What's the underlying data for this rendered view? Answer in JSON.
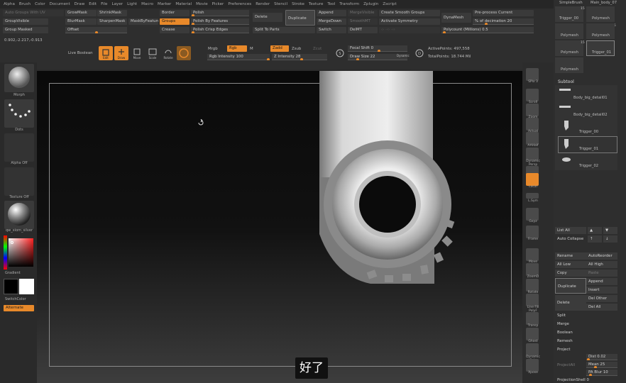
{
  "menu": [
    "Alpha",
    "Brush",
    "Color",
    "Document",
    "Draw",
    "Edit",
    "File",
    "Layer",
    "Light",
    "Macro",
    "Marker",
    "Material",
    "Movie",
    "Picker",
    "Preferences",
    "Render",
    "Stencil",
    "Stroke",
    "Texture",
    "Tool",
    "Transform",
    "Zplugin",
    "Zscript"
  ],
  "top_buttons": {
    "auto_groups": "Auto Groups With UV",
    "group_visible": "GroupVisible",
    "group_masked": "Group Masked",
    "coords": "0.902,-2.217,-0.913",
    "grow_mask": "GrowMask",
    "shrink_mask": "ShrinkMask",
    "blur_mask": "BlurMask",
    "sharpen_mask": "SharpenMask",
    "offset": "Offset",
    "mask_by_feature": "MaskByFeature",
    "border": "Border",
    "groups": "Groups",
    "crease": "Crease",
    "polish": "Polish",
    "polish_by_features": "Polish By Features",
    "polish_crisp": "Polish Crisp Edges",
    "delete": "Delete",
    "duplicate": "Duplicate",
    "split_to_parts": "Split To Parts",
    "append": "Append",
    "merge_down": "MergeDown",
    "switch": "Switch",
    "merge_visible": "MergeVisible",
    "smooth_mt": "SmoothMT",
    "del_mt": "DelMT",
    "create_smooth_groups": "Create Smooth Groups",
    "activate_symmetry": "Activate Symmetry",
    "dynamesh": "DynaMesh",
    "preprocess_current": "Pre-process Current",
    "pct_decimation_label": "% of decimation",
    "pct_decimation_value": "20",
    "polycount_label": "Polycount (Millions)",
    "polycount_value": "0.5"
  },
  "toolbar": {
    "live_boolean": "Live Boolean",
    "edit": "Edit",
    "draw": "Draw",
    "move": "Move",
    "scale": "Scale",
    "rotate": "Rotate",
    "mrgb": "Mrgb",
    "rgb": "Rgb",
    "m": "M",
    "zadd": "Zadd",
    "zsub": "Zsub",
    "zcut": "Zcut",
    "rgb_intensity_label": "Rgb Intensity",
    "rgb_intensity_value": "100",
    "z_intensity_label": "Z Intensity",
    "z_intensity_value": "28",
    "focal_shift_label": "Focal Shift",
    "focal_shift_value": "0",
    "draw_size_label": "Draw Size",
    "draw_size_value": "22",
    "dynamic": "Dynamic",
    "active_points_label": "ActivePoints:",
    "active_points_value": "497,558",
    "total_points_label": "TotalPoints:",
    "total_points_value": "18.744 Mil"
  },
  "left_shelf": {
    "morph": "Morph",
    "dots": "Dots",
    "alpha_off": "Alpha Off",
    "texture_off": "Texture Off",
    "material": "qw_xiom_silver",
    "gradient": "Gradient",
    "switch_color": "SwitchColor",
    "alternate": "Alternate"
  },
  "right_shelf": [
    "SPix 3",
    "Scroll",
    "Zoom",
    "Actual",
    "AAHalf",
    "Dynamic Persp",
    "Floor",
    "Local",
    "L.Sym",
    "Gxyz",
    "Frame",
    "Move",
    "ZoomD",
    "Rotate",
    "Line Fill PolyF",
    "Transp",
    "Ghost",
    "Dynamic Solo",
    "Xpose"
  ],
  "subtool_panel": {
    "top_thumbs": [
      "SimpleBrush",
      "Main_body_07",
      "Trigger_00",
      "Polymesh",
      "Polymesh",
      "Polymesh",
      "Polymesh",
      "Trigger_01",
      "Polymesh"
    ],
    "thumb_counts": [
      "15",
      "15",
      "15"
    ],
    "title": "Subtool",
    "items": [
      "Body_big_detail01",
      "Body_big_detail02",
      "Trigger_00",
      "Trigger_01",
      "Trigger_02"
    ],
    "list_all": "List All",
    "auto_collapse": "Auto Collapse",
    "rename": "Rename",
    "auto_reorder": "AutoReorder",
    "all_low": "All Low",
    "all_high": "All High",
    "copy": "Copy",
    "paste": "Paste",
    "duplicate": "Duplicate",
    "append": "Append",
    "insert": "Insert",
    "delete": "Delete",
    "del_other": "Del Other",
    "del_all": "Del All",
    "split": "Split",
    "merge": "Merge",
    "boolean": "Boolean",
    "remesh": "Remesh",
    "project": "Project",
    "project_all": "ProjectAll",
    "dist_label": "Dist",
    "dist_value": "0.02",
    "mean_label": "Mean",
    "mean_value": "25",
    "pa_blur_label": "PA Blur",
    "pa_blur_value": "10",
    "projection_shell": "ProjectionShell 0"
  },
  "subtitle": "好了"
}
